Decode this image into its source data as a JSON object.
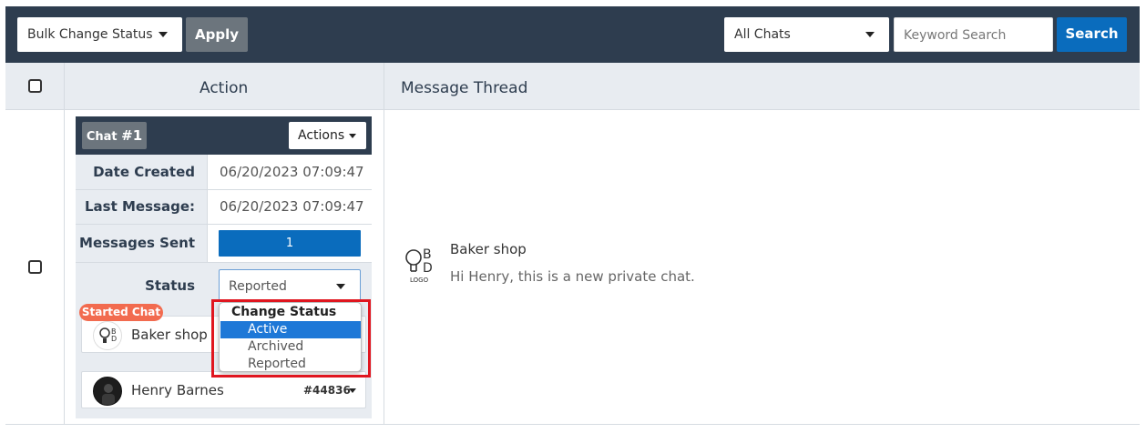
{
  "toolbar": {
    "bulk_status_label": "Bulk Change Status",
    "apply_label": "Apply",
    "chat_filter_value": "All Chats",
    "keyword_placeholder": "Keyword Search",
    "search_label": "Search"
  },
  "table": {
    "headers": {
      "action": "Action",
      "thread": "Message Thread"
    }
  },
  "chat": {
    "badge_prefix": "Chat",
    "badge_number": "#1",
    "actions_label": "Actions",
    "rows": {
      "date_created_label": "Date Created",
      "date_created_value": "06/20/2023 07:09:47",
      "last_message_label": "Last Message:",
      "last_message_value": "06/20/2023 07:09:47",
      "messages_sent_label": "Messages Sent",
      "messages_sent_value": "1",
      "status_label": "Status",
      "status_value": "Reported"
    },
    "status_dropdown": {
      "group_label": "Change Status",
      "options": [
        "Active",
        "Archived",
        "Reported"
      ],
      "highlighted": "Active"
    },
    "started_badge": "Started Chat",
    "parties": [
      {
        "name": "Baker shop",
        "avatar": "bd-logo-icon"
      },
      {
        "name": "Henry Barnes",
        "id": "#44836",
        "avatar": "user-avatar"
      }
    ]
  },
  "thread": {
    "sender": "Baker shop",
    "message": "Hi Henry, this is a new private chat.",
    "logo_letters": [
      "B",
      "D"
    ],
    "logo_caption": "LOGO"
  },
  "colors": {
    "toolbar_bg": "#2e3d4f",
    "primary": "#0a6cbd",
    "secondary": "#6c757d",
    "badge": "#f26b4f",
    "highlight": "#e0161f"
  }
}
